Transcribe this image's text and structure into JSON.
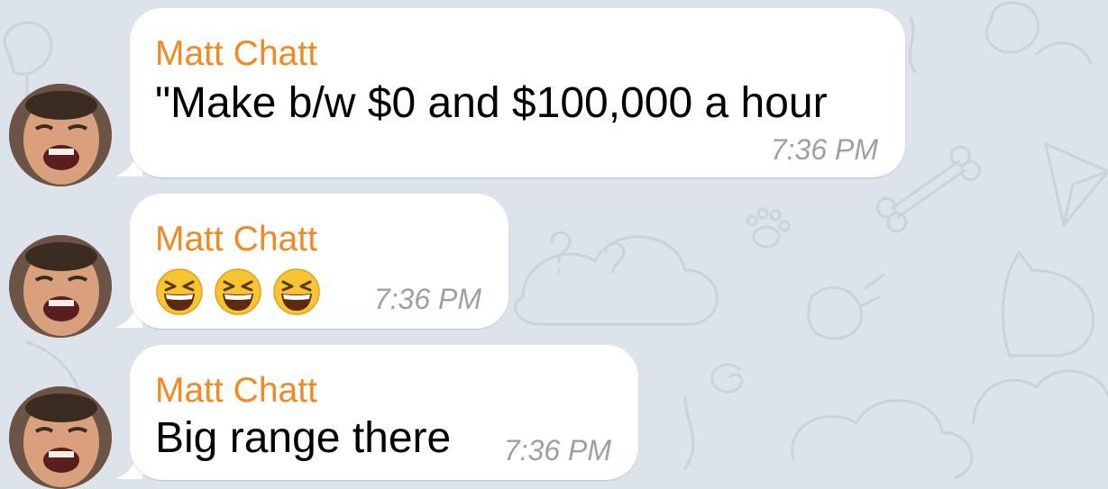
{
  "messages": [
    {
      "sender": "Matt Chatt",
      "text": "\"Make b/w $0 and $100,000 a hour",
      "time": "7:36 PM"
    },
    {
      "sender": "Matt Chatt",
      "emoji_name": "grinning-squinting-face",
      "emoji_count": 3,
      "time": "7:36 PM"
    },
    {
      "sender": "Matt Chatt",
      "text": "Big range there",
      "time": "7:36 PM"
    }
  ],
  "colors": {
    "background": "#dde3eb",
    "bubble": "#ffffff",
    "sender_name": "#f08a24",
    "timestamp": "#9aa0a6",
    "message_text": "#000000"
  }
}
